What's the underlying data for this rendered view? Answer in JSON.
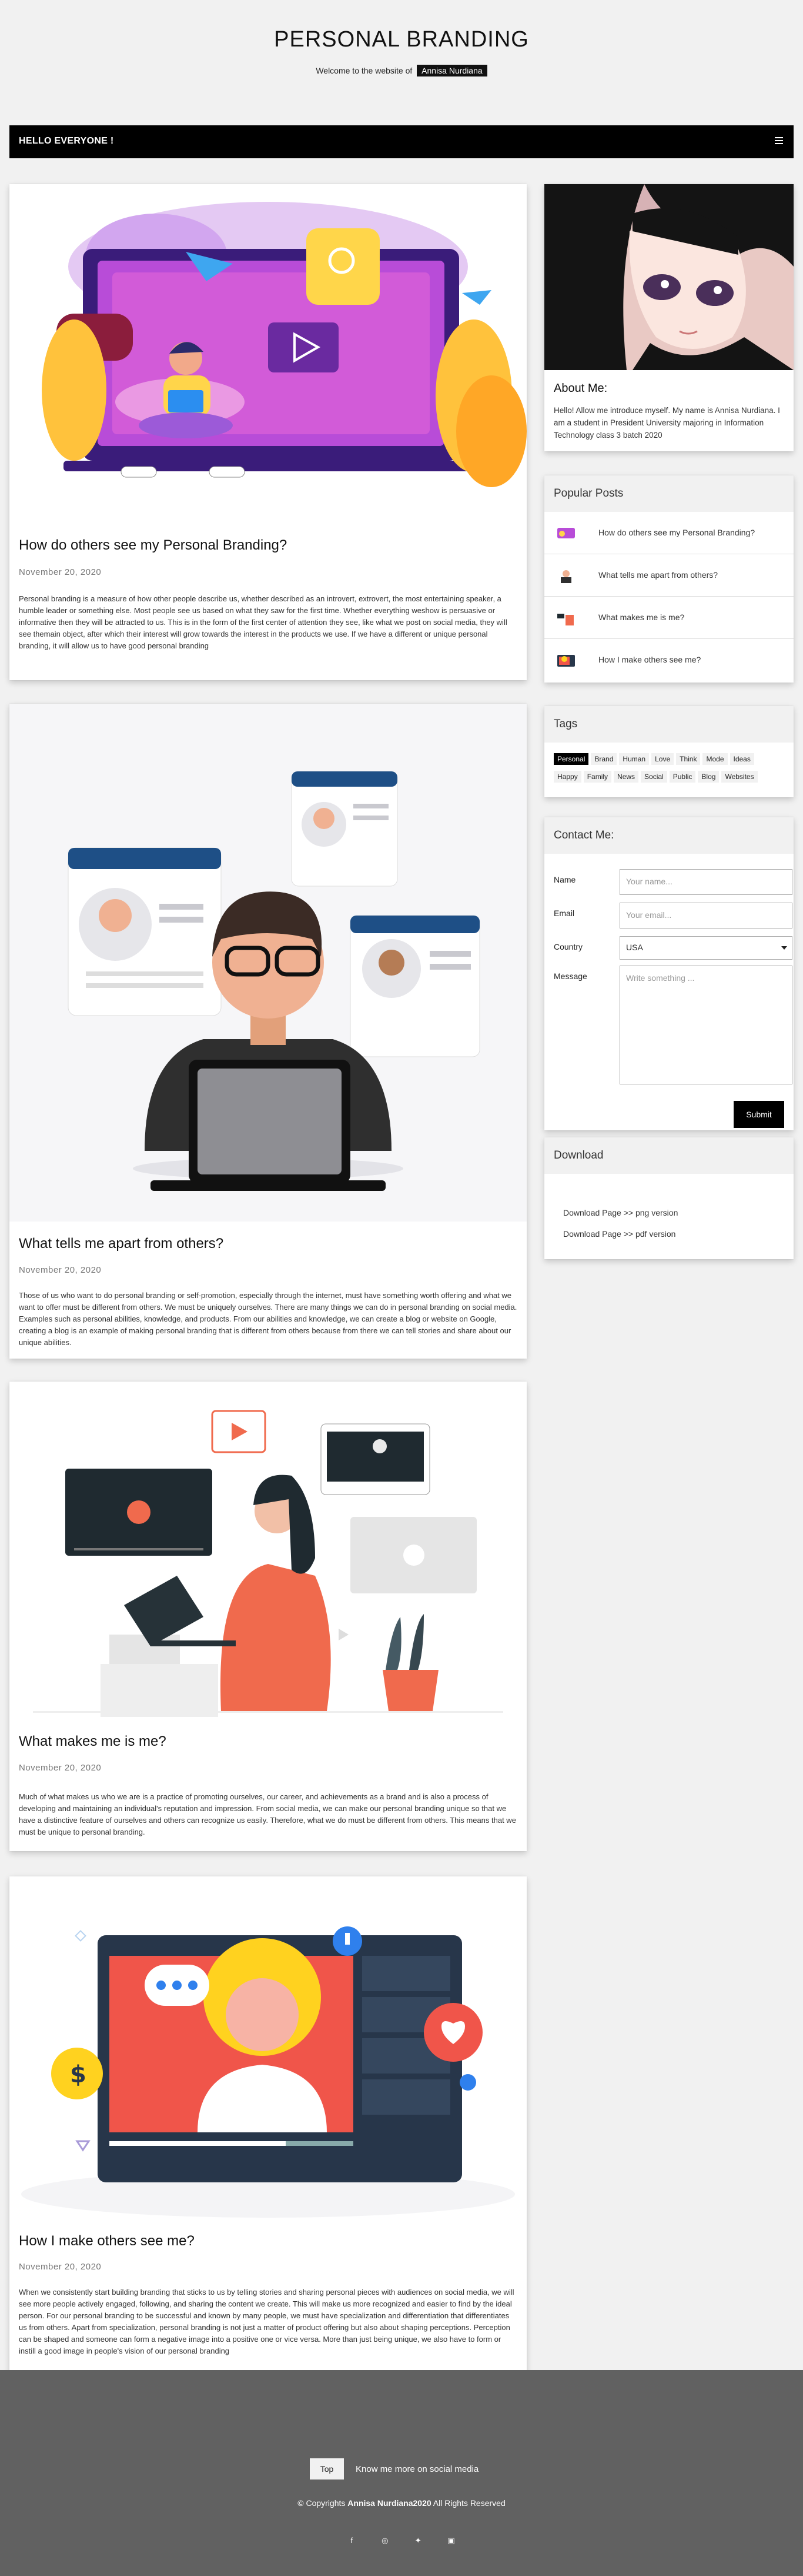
{
  "header": {
    "title": "PERSONAL BRANDING",
    "welcome_text": "Welcome to the website of",
    "author": "Annisa Nurdiana"
  },
  "navbar": {
    "title": "HELLO EVERYONE !",
    "menu_icon": "hamburger-icon"
  },
  "posts": [
    {
      "title": "How do others see my Personal Branding?",
      "date": "November 20, 2020",
      "body": "Personal branding is a measure of how other people describe us, whether described as an introvert, extrovert, the most entertaining speaker, a humble leader or something else. Most people see us based on what they saw for the first time. Whether everything weshow is persuasive or informative then they will be attracted to us. This is in the form of the first center of attention they see, like what we post on social media, they will see themain object, after which their interest will grow towards the interest in the products we use. If we have a different or unique personal branding, it will allow us to have good personal branding"
    },
    {
      "title": "What tells me apart from others?",
      "date": "November 20, 2020",
      "body": "Those of us who want to do personal branding or self-promotion, especially through the internet, must have something worth offering and what we want to offer must be different from others. We must be uniquely ourselves. There are many things we can do in personal branding on social media. Examples such as personal abilities, knowledge, and products. From our abilities and knowledge, we can create a blog or website on Google, creating a blog is an example of making personal branding that is different from others because from there we can tell stories and share about our unique abilities."
    },
    {
      "title": "What makes me is me?",
      "date": "November 20, 2020",
      "body": "Much of what makes us who we are is a practice of promoting ourselves, our career, and achievements as a brand and is also a process of developing and maintaining an individual's reputation and impression. From social media, we can make our personal branding unique so that we have a distinctive feature of ourselves and others can recognize us easily. Therefore, what we do must be different from others. This means that we must be unique to personal branding."
    },
    {
      "title": "How I make others see me?",
      "date": "November 20, 2020",
      "body": "When we consistently start building branding that sticks to us by telling stories and sharing personal pieces with audiences on social media, we will see more people actively engaged, following, and sharing the content we create. This will make us more recognized and easier to find by the ideal person. For our personal branding to be successful and known by many people, we must have specialization and differentiation that differentiates us from others. Apart from specialization, personal branding is not just a matter of product offering but also about shaping perceptions. Perception can be shaped and someone can form a negative image into a positive one or vice versa. More than just being unique, we also have to form or instill a good image in people's vision of our personal branding"
    }
  ],
  "about": {
    "title": "About Me:",
    "text": "Hello! Allow me introduce myself. My name is Annisa Nurdiana. I am a student in President University majoring in Information Technology class 3 batch 2020"
  },
  "popular": {
    "title": "Popular Posts",
    "items": [
      "How do others see my Personal Branding?",
      "What tells me apart from others?",
      "What makes me is me?",
      "How I make others see me?"
    ]
  },
  "tags": {
    "title": "Tags",
    "items": [
      "Personal",
      "Brand",
      "Human",
      "Love",
      "Think",
      "Mode",
      "Ideas",
      "Happy",
      "Family",
      "News",
      "Social",
      "Public",
      "Blog",
      "Websites"
    ]
  },
  "contact": {
    "title": "Contact Me:",
    "name_label": "Name",
    "name_placeholder": "Your name...",
    "email_label": "Email",
    "email_placeholder": "Your email...",
    "country_label": "Country",
    "country_value": "USA",
    "message_label": "Message",
    "message_placeholder": "Write something ...",
    "submit": "Submit"
  },
  "download": {
    "title": "Download",
    "links": [
      "Download Page >> png version",
      "Download Page >> pdf version"
    ]
  },
  "footer": {
    "top_button": "Top",
    "social_text": "Know me more on social media",
    "copyright_prefix": "© Copyrights",
    "copyright_name": "Annisa Nurdiana2020",
    "copyright_suffix": "All Rights Reserved",
    "icons": [
      "facebook-icon",
      "instagram-icon",
      "twitter-icon",
      "linkedin-icon"
    ]
  }
}
